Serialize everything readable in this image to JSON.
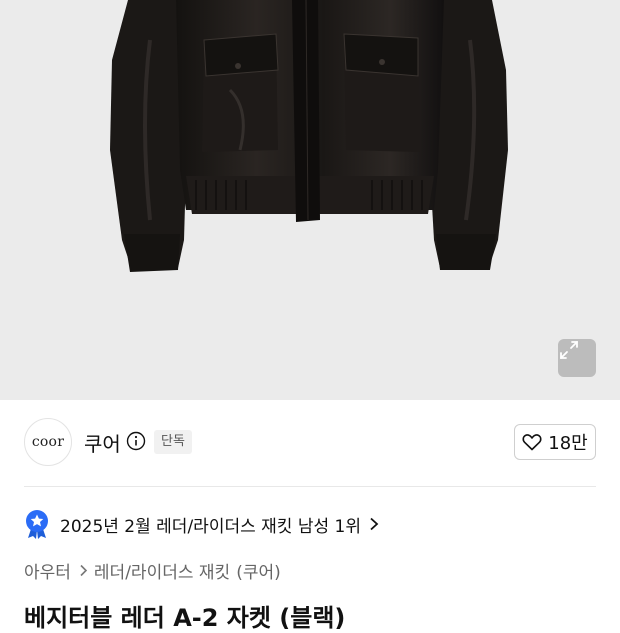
{
  "product_image": {
    "alt_icon": "leather-jacket-photo",
    "expand_icon": "expand-arrows-icon"
  },
  "brand": {
    "logo_text": "coor",
    "name": "쿠어",
    "exclusive_badge": "단독",
    "like_count": "18만"
  },
  "ranking": {
    "text": "2025년 2월 레더/라이더스 재킷 남성 1위"
  },
  "breadcrumb": {
    "category": "아우터",
    "subcategory": "레더/라이더스 재킷",
    "brand": "(쿠어)"
  },
  "product": {
    "title": "베지터블 레더 A-2 자켓 (블랙)"
  },
  "colors": {
    "ranking_badge": "#2b6cf6",
    "image_bg": "#ebebeb"
  }
}
